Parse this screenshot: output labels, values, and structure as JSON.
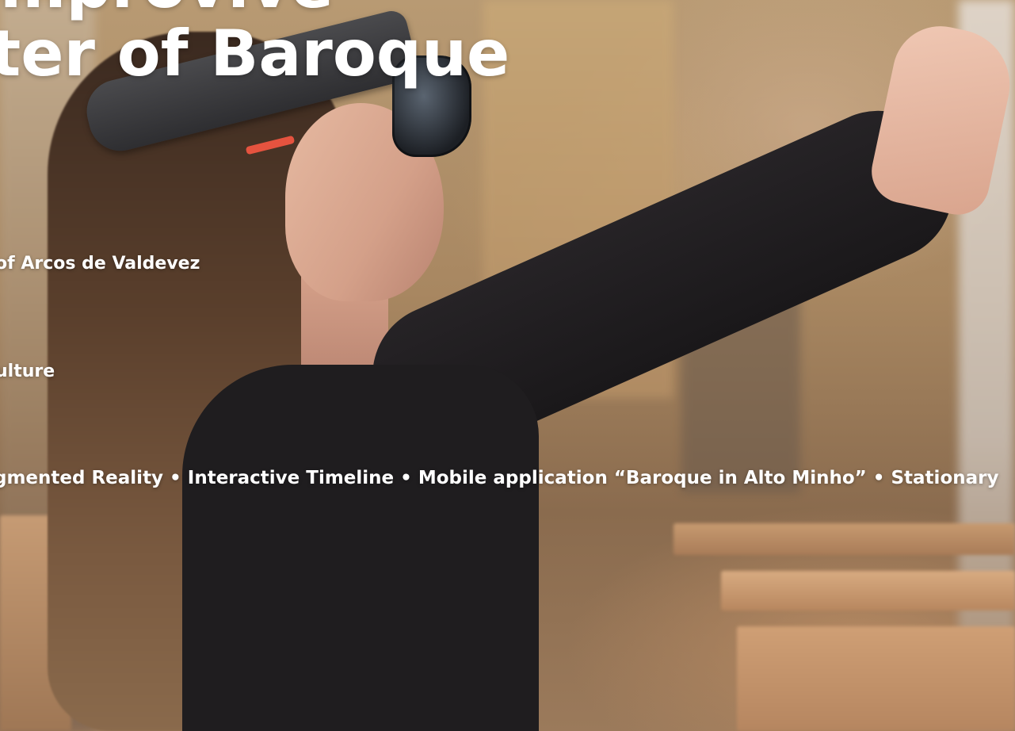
{
  "hero": {
    "title_line1": "mprovive",
    "title_line2": "ter of Baroque",
    "location_text": "of Arcos de Valdevez",
    "category_text": "ulture",
    "features_text": "gmented Reality • Interactive Timeline • Mobile application “Baroque in Alto Minho” • Stationary"
  },
  "colors": {
    "text": "#ffffff",
    "headset_accent": "#e5533f"
  }
}
